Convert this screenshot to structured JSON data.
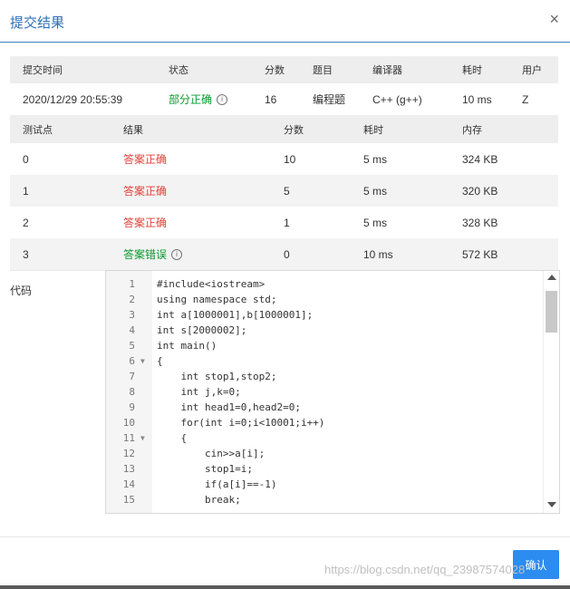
{
  "dialog": {
    "title": "提交结果",
    "close_glyph": "×"
  },
  "summary": {
    "headers": [
      "提交时间",
      "状态",
      "分数",
      "题目",
      "编译器",
      "耗时",
      "用户"
    ],
    "row": {
      "time": "2020/12/29 20:55:39",
      "status": "部分正确",
      "status_info": "i",
      "score": "16",
      "problem": "编程题",
      "compiler": "C++ (g++)",
      "elapsed": "10 ms",
      "user": "Z"
    }
  },
  "testcases": {
    "headers": [
      "测试点",
      "结果",
      "分数",
      "耗时",
      "内存"
    ],
    "rows": [
      {
        "id": "0",
        "result": "答案正确",
        "score": "10",
        "time": "5 ms",
        "memory": "324 KB"
      },
      {
        "id": "1",
        "result": "答案正确",
        "score": "5",
        "time": "5 ms",
        "memory": "320 KB"
      },
      {
        "id": "2",
        "result": "答案正确",
        "score": "1",
        "time": "5 ms",
        "memory": "328 KB"
      },
      {
        "id": "3",
        "result": "答案错误",
        "score": "0",
        "time": "10 ms",
        "memory": "572 KB"
      }
    ]
  },
  "code": {
    "label": "代码",
    "lines": [
      "#include<iostream>",
      "using namespace std;",
      "int a[1000001],b[1000001];",
      "int s[2000002];",
      "int main()",
      "{",
      "    int stop1,stop2;",
      "    int j,k=0;",
      "    int head1=0,head2=0;",
      "    for(int i=0;i<10001;i++)",
      "    {",
      "        cin>>a[i];",
      "        stop1=i;",
      "        if(a[i]==-1)",
      "        break;"
    ],
    "fold_lines": [
      6,
      11
    ]
  },
  "footer": {
    "confirm_label": "确认"
  },
  "watermark": "https://blog.csdn.net/qq_23987574028",
  "colors": {
    "accent": "#2d8cf0",
    "title": "#2d6fb8",
    "correct_status": "#0a9a2e",
    "result_red": "#e0413a"
  }
}
